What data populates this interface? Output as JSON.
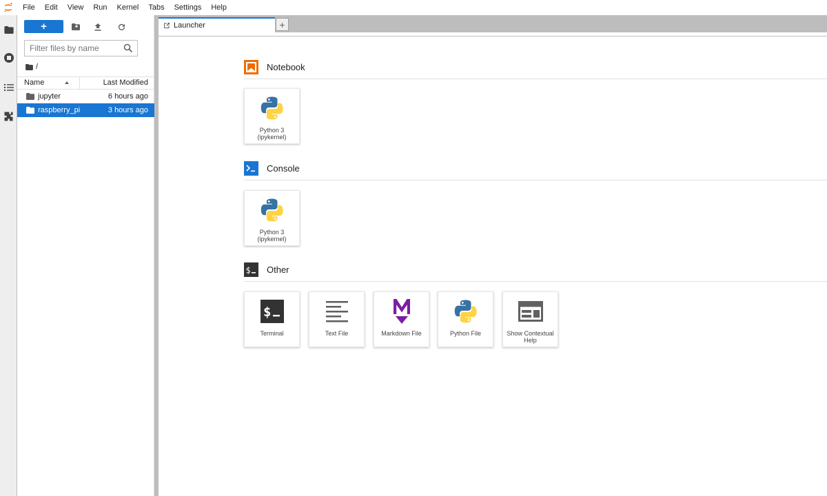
{
  "menu": [
    "File",
    "Edit",
    "View",
    "Run",
    "Kernel",
    "Tabs",
    "Settings",
    "Help"
  ],
  "file_browser": {
    "new_button_label": "+",
    "filter_placeholder": "Filter files by name",
    "breadcrumb": "/",
    "columns": {
      "name": "Name",
      "modified": "Last Modified"
    },
    "files": [
      {
        "name": "jupyter",
        "modified": "6 hours ago",
        "selected": false
      },
      {
        "name": "raspberry_pi",
        "modified": "3 hours ago",
        "selected": true
      }
    ]
  },
  "tabs": {
    "active_label": "Launcher",
    "add_label": "+"
  },
  "launcher": {
    "sections": [
      {
        "title": "Notebook",
        "icon": "notebook-icon"
      },
      {
        "title": "Console",
        "icon": "console-icon"
      },
      {
        "title": "Other",
        "icon": "terminal-icon"
      }
    ],
    "notebook_cards": [
      {
        "line1": "Python 3",
        "line2": "(ipykernel)"
      }
    ],
    "console_cards": [
      {
        "line1": "Python 3",
        "line2": "(ipykernel)"
      }
    ],
    "other_cards": [
      {
        "line1": "Terminal",
        "line2": "",
        "icon": "terminal-icon"
      },
      {
        "line1": "Text File",
        "line2": "",
        "icon": "text-file-icon"
      },
      {
        "line1": "Markdown File",
        "line2": "",
        "icon": "markdown-icon"
      },
      {
        "line1": "Python File",
        "line2": "",
        "icon": "python-icon"
      },
      {
        "line1": "Show Contextual",
        "line2": "Help",
        "icon": "contextual-help-icon"
      }
    ]
  },
  "colors": {
    "accent": "#1976d2",
    "notebook_orange": "#ef6c00",
    "markdown_purple": "#7b1fa2",
    "python_blue": "#3672a4",
    "python_yellow": "#ffd343"
  }
}
